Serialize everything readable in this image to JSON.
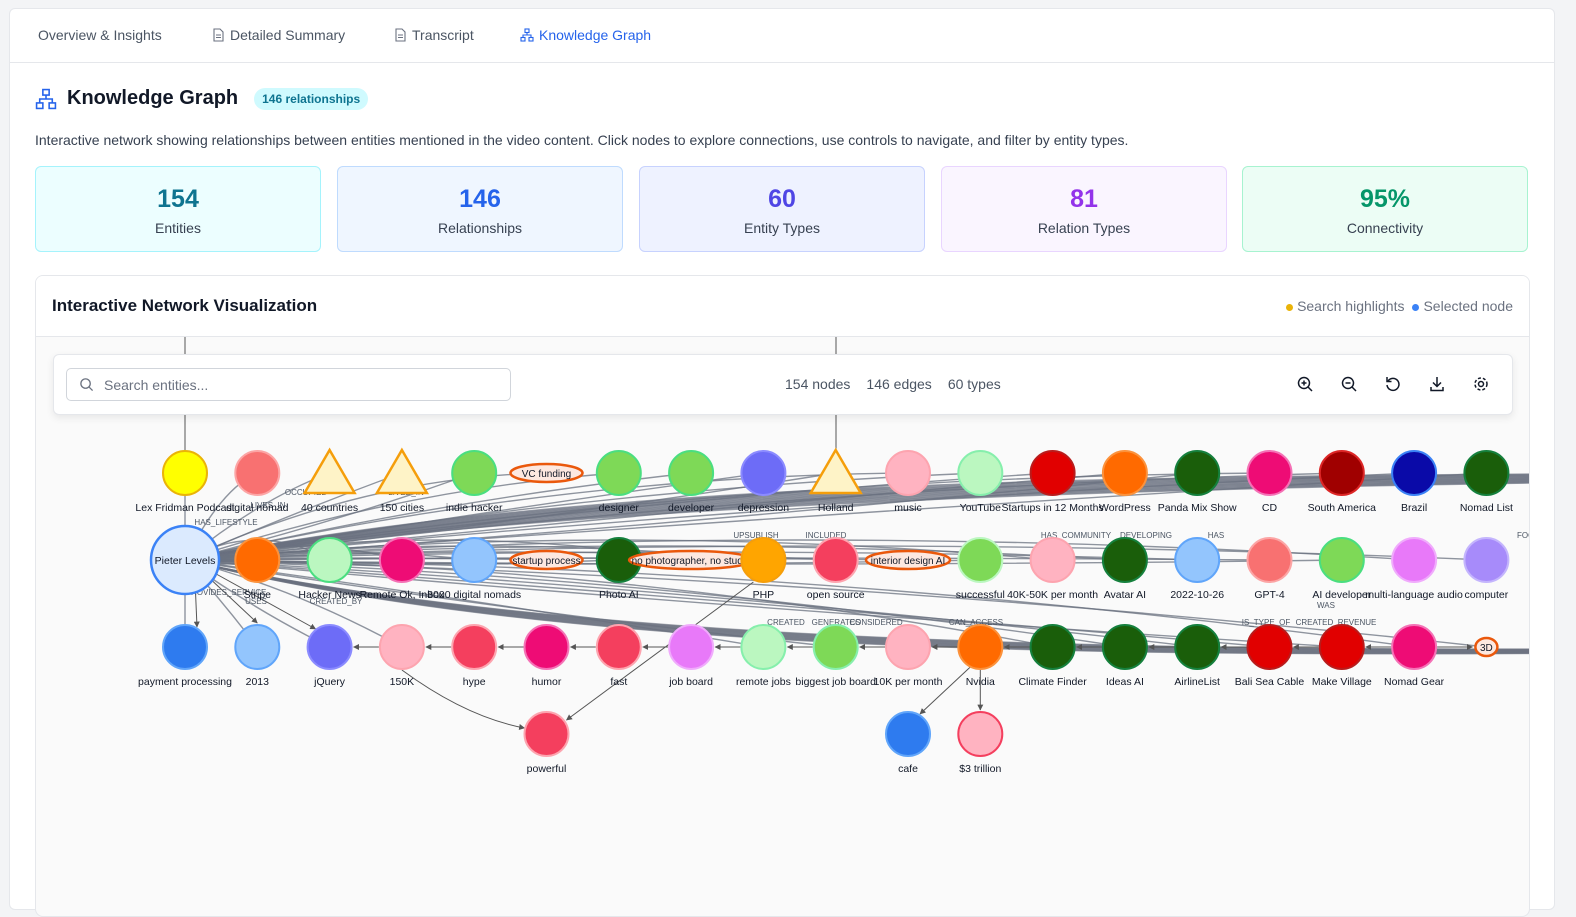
{
  "tabs": [
    {
      "label": "Overview & Insights",
      "icon": ""
    },
    {
      "label": "Detailed Summary",
      "icon": "document-icon"
    },
    {
      "label": "Transcript",
      "icon": "document-icon"
    },
    {
      "label": "Knowledge Graph",
      "icon": "network-icon",
      "active": true
    }
  ],
  "header": {
    "title": "Knowledge Graph",
    "badge": "146 relationships",
    "description": "Interactive network showing relationships between entities mentioned in the video content. Click nodes to explore connections, use controls to navigate, and filter by entity types."
  },
  "stats": [
    {
      "value": "154",
      "label": "Entities",
      "color": "#0e7490",
      "bg": "#ecfeff",
      "border": "#a5f3fc"
    },
    {
      "value": "146",
      "label": "Relationships",
      "color": "#2563eb",
      "bg": "#eff6ff",
      "border": "#bfdbfe"
    },
    {
      "value": "60",
      "label": "Entity Types",
      "color": "#4f46e5",
      "bg": "#eef2ff",
      "border": "#c7d2fe"
    },
    {
      "value": "81",
      "label": "Relation Types",
      "color": "#9333ea",
      "bg": "#faf5ff",
      "border": "#e9d5ff"
    },
    {
      "value": "95%",
      "label": "Connectivity",
      "color": "#059669",
      "bg": "#ecfdf5",
      "border": "#a7f3d0"
    }
  ],
  "panel": {
    "title": "Interactive Network Visualization",
    "legend_search": "Search highlights",
    "legend_selected": "Selected node",
    "search_color": "#eab308",
    "selected_color": "#3b82f6"
  },
  "toolbar": {
    "search_placeholder": "Search entities...",
    "nodes": "154 nodes",
    "edges": "146 edges",
    "types": "60 types",
    "tools": [
      "zoom-in-icon",
      "zoom-out-icon",
      "reset-icon",
      "download-icon",
      "settings-icon"
    ]
  },
  "graph": {
    "nodes": [
      {
        "id": "lex",
        "label": "Lex Fridman Podcast",
        "shape": "circle",
        "fill": "#ffff00",
        "stroke": "#eab308"
      },
      {
        "id": "dn",
        "label": "digital nomad",
        "shape": "circle",
        "fill": "#f87171",
        "stroke": "#fca5a5"
      },
      {
        "id": "c40",
        "label": "40 countries",
        "shape": "triangle",
        "fill": "#fef3c7",
        "stroke": "#f59e0b"
      },
      {
        "id": "c150",
        "label": "150 cities",
        "shape": "triangle",
        "fill": "#fef3c7",
        "stroke": "#f59e0b"
      },
      {
        "id": "ih",
        "label": "indie hacker",
        "shape": "circle",
        "fill": "#7ed957",
        "stroke": "#4ade80"
      },
      {
        "id": "vc",
        "label": "VC funding",
        "shape": "ellipse",
        "fill": "#fde8e0",
        "stroke": "#ea580c"
      },
      {
        "id": "des",
        "label": "designer",
        "shape": "circle",
        "fill": "#7ed957",
        "stroke": "#4ade80"
      },
      {
        "id": "dev",
        "label": "developer",
        "shape": "circle",
        "fill": "#7ed957",
        "stroke": "#4ade80"
      },
      {
        "id": "dep",
        "label": "depression",
        "shape": "circle",
        "fill": "#6d6cf7",
        "stroke": "#8b8bff"
      },
      {
        "id": "hol",
        "label": "Holland",
        "shape": "triangle",
        "fill": "#fef3c7",
        "stroke": "#f59e0b"
      },
      {
        "id": "mus",
        "label": "music",
        "shape": "circle",
        "fill": "#ffb3c1",
        "stroke": "#fda4af"
      },
      {
        "id": "yt",
        "label": "YouTube",
        "shape": "circle",
        "fill": "#bbf7c0",
        "stroke": "#86efac"
      },
      {
        "id": "s12",
        "label": "Startups in 12 Months",
        "shape": "circle",
        "fill": "#e10000",
        "stroke": "#b91c1c"
      },
      {
        "id": "wp",
        "label": "WordPress",
        "shape": "circle",
        "fill": "#ff6a00",
        "stroke": "#fb923c"
      },
      {
        "id": "pm",
        "label": "Panda Mix Show",
        "shape": "circle",
        "fill": "#1a5e0a",
        "stroke": "#15803d"
      },
      {
        "id": "cd",
        "label": "CD",
        "shape": "circle",
        "fill": "#ee0c75",
        "stroke": "#f472b6"
      },
      {
        "id": "sa",
        "label": "South America",
        "shape": "circle",
        "fill": "#a00000",
        "stroke": "#dc2626"
      },
      {
        "id": "br",
        "label": "Brazil",
        "shape": "circle",
        "fill": "#0a0aa8",
        "stroke": "#3b82f6"
      },
      {
        "id": "nl",
        "label": "Nomad List",
        "shape": "circle",
        "fill": "#1a5e0a",
        "stroke": "#15803d"
      },
      {
        "id": "pl",
        "label": "Pieter Levels",
        "shape": "circle",
        "fill": "#dbeafe",
        "stroke": "#3b82f6"
      },
      {
        "id": "stripe",
        "label": "Stripe",
        "shape": "circle",
        "fill": "#ff6a00",
        "stroke": "#fb923c"
      },
      {
        "id": "hn",
        "label": "Hacker News",
        "shape": "circle",
        "fill": "#bbf7c0",
        "stroke": "#4ade80"
      },
      {
        "id": "rml",
        "label": "Remote Ok, Inbox",
        "shape": "circle",
        "fill": "#ee0c75",
        "stroke": "#f472b6"
      },
      {
        "id": "k3",
        "label": "3000 digital nomads",
        "shape": "circle",
        "fill": "#93c5fd",
        "stroke": "#60a5fa"
      },
      {
        "id": "sp",
        "label": "startup process",
        "shape": "ellipse",
        "fill": "#fde8e0",
        "stroke": "#ea580c"
      },
      {
        "id": "pai",
        "label": "Photo AI",
        "shape": "circle",
        "fill": "#1a5e0a",
        "stroke": "#15803d"
      },
      {
        "id": "np",
        "label": "no photographer, no studio",
        "shape": "ellipse",
        "fill": "#fde8e0",
        "stroke": "#ea580c"
      },
      {
        "id": "php",
        "label": "PHP",
        "shape": "circle",
        "fill": "#ffa500",
        "stroke": "#f59e0b"
      },
      {
        "id": "os",
        "label": "open source",
        "shape": "circle",
        "fill": "#f43f5e",
        "stroke": "#fda4af"
      },
      {
        "id": "idai",
        "label": "interior design AI",
        "shape": "ellipse",
        "fill": "#fde8e0",
        "stroke": "#ea580c"
      },
      {
        "id": "succ",
        "label": "successful",
        "shape": "circle",
        "fill": "#7ed957",
        "stroke": "#bbf7c0"
      },
      {
        "id": "k40",
        "label": "40K-50K per month",
        "shape": "circle",
        "fill": "#ffb3c1",
        "stroke": "#fda4af"
      },
      {
        "id": "aai",
        "label": "Avatar AI",
        "shape": "circle",
        "fill": "#1a5e0a",
        "stroke": "#15803d"
      },
      {
        "id": "d22",
        "label": "2022-10-26",
        "shape": "circle",
        "fill": "#93c5fd",
        "stroke": "#60a5fa"
      },
      {
        "id": "gpt",
        "label": "GPT-4",
        "shape": "circle",
        "fill": "#f87171",
        "stroke": "#fca5a5"
      },
      {
        "id": "aid",
        "label": "AI developer",
        "shape": "circle",
        "fill": "#7ed957",
        "stroke": "#4ade80"
      },
      {
        "id": "mla",
        "label": "multi-language audio",
        "shape": "circle",
        "fill": "#e879f9",
        "stroke": "#f0abfc"
      },
      {
        "id": "comp",
        "label": "computer",
        "shape": "circle",
        "fill": "#a78bfa",
        "stroke": "#c4b5fd"
      },
      {
        "id": "pp",
        "label": "payment processing",
        "shape": "circle",
        "fill": "#2e7bef",
        "stroke": "#60a5fa"
      },
      {
        "id": "y13",
        "label": "2013",
        "shape": "circle",
        "fill": "#93c5fd",
        "stroke": "#60a5fa"
      },
      {
        "id": "jq",
        "label": "jQuery",
        "shape": "circle",
        "fill": "#6d6cf7",
        "stroke": "#8b8bff"
      },
      {
        "id": "k150",
        "label": "150K",
        "shape": "circle",
        "fill": "#ffb3c1",
        "stroke": "#fda4af"
      },
      {
        "id": "hype",
        "label": "hype",
        "shape": "circle",
        "fill": "#f43f5e",
        "stroke": "#fda4af"
      },
      {
        "id": "hum",
        "label": "humor",
        "shape": "circle",
        "fill": "#ee0c75",
        "stroke": "#f472b6"
      },
      {
        "id": "fast",
        "label": "fast",
        "shape": "circle",
        "fill": "#f43f5e",
        "stroke": "#fda4af"
      },
      {
        "id": "jb",
        "label": "job board",
        "shape": "circle",
        "fill": "#e879f9",
        "stroke": "#f0abfc"
      },
      {
        "id": "rj",
        "label": "remote jobs",
        "shape": "circle",
        "fill": "#bbf7c0",
        "stroke": "#86efac"
      },
      {
        "id": "bjb",
        "label": "biggest job board",
        "shape": "circle",
        "fill": "#7ed957",
        "stroke": "#86efac"
      },
      {
        "id": "k10",
        "label": "10K per month",
        "shape": "circle",
        "fill": "#ffb3c1",
        "stroke": "#fda4af"
      },
      {
        "id": "nv",
        "label": "Nvidia",
        "shape": "circle",
        "fill": "#ff6a00",
        "stroke": "#fb923c"
      },
      {
        "id": "cf",
        "label": "Climate Finder",
        "shape": "circle",
        "fill": "#1a5e0a",
        "stroke": "#15803d"
      },
      {
        "id": "iai",
        "label": "Ideas AI",
        "shape": "circle",
        "fill": "#1a5e0a",
        "stroke": "#15803d"
      },
      {
        "id": "al",
        "label": "AirlineList",
        "shape": "circle",
        "fill": "#1a5e0a",
        "stroke": "#15803d"
      },
      {
        "id": "bsc",
        "label": "Bali Sea Cable",
        "shape": "circle",
        "fill": "#e10000",
        "stroke": "#b91c1c"
      },
      {
        "id": "mv",
        "label": "Make Village",
        "shape": "circle",
        "fill": "#e10000",
        "stroke": "#b91c1c"
      },
      {
        "id": "ng",
        "label": "Nomad Gear",
        "shape": "circle",
        "fill": "#ee0c75",
        "stroke": "#f472b6"
      },
      {
        "id": "d3",
        "label": "3D",
        "shape": "ellipse",
        "fill": "#fde8e0",
        "stroke": "#ea580c"
      },
      {
        "id": "pow",
        "label": "powerful",
        "shape": "circle",
        "fill": "#f43f5e",
        "stroke": "#fda4af"
      },
      {
        "id": "cafe",
        "label": "cafe",
        "shape": "circle",
        "fill": "#2e7bef",
        "stroke": "#60a5fa"
      },
      {
        "id": "t3",
        "label": "$3 trillion",
        "shape": "circle",
        "fill": "#ffb3c1",
        "stroke": "#f43f5e"
      }
    ],
    "edge_labels": [
      "OCCUPIED",
      "LIVED_IN",
      "LIVES_IN",
      "HAS_LIFESTYLE",
      "PROVIDES_SERVICE",
      "USES",
      "CREATED_BY",
      "IS",
      "UPSUBLISH",
      "INCLUDED",
      "HAS_COMMUNITY",
      "DEVELOPING",
      "HAS",
      "WAS",
      "CREATED",
      "GENERATES",
      "CONSIDERED",
      "CAN_ACCESS",
      "IS_TYPE_OF",
      "CREATED_REVENUE",
      "FOCUS"
    ]
  }
}
